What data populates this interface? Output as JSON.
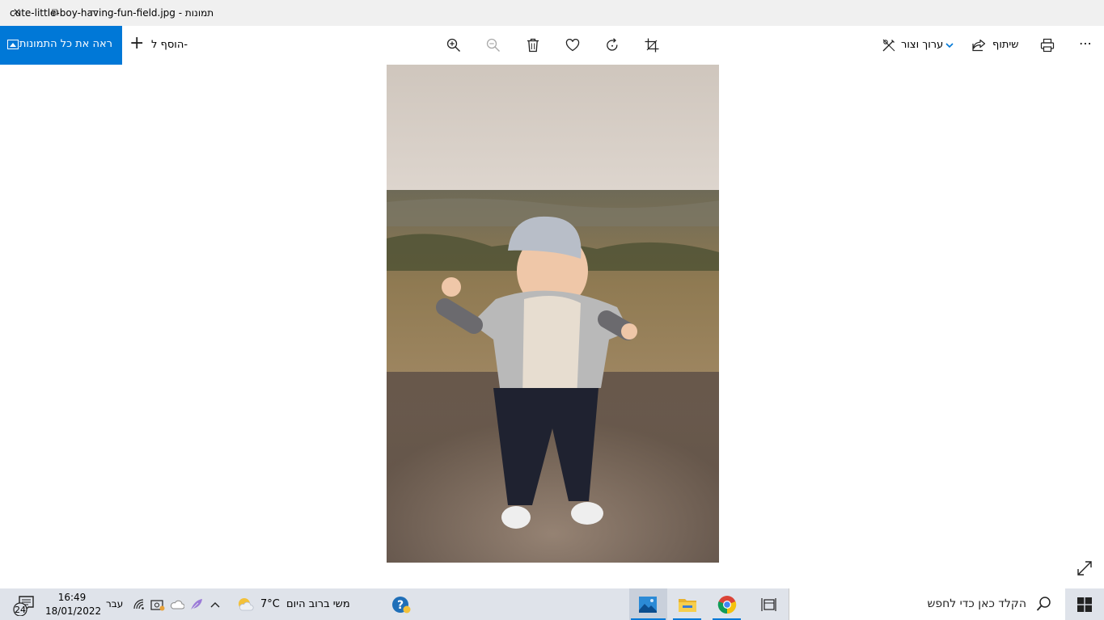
{
  "window": {
    "title": "cute-little-boy-having-fun-field.jpg - תמונות",
    "close_glyph": "✕",
    "restore_glyph": "⧉",
    "minimize_glyph": "—"
  },
  "toolbar": {
    "see_all_label": "ראה את כל התמונות",
    "add_to_label": "הוסף ל-",
    "edit_create_label": "ערוך וצור",
    "share_label": "שיתוף",
    "more_glyph": "⋯"
  },
  "icons": {
    "zoom_in": "zoom-in-icon",
    "zoom_out": "zoom-out-icon",
    "delete": "trash-icon",
    "favorite": "heart-icon",
    "rotate": "rotate-icon",
    "crop": "crop-icon",
    "print": "printer-icon",
    "fullscreen": "expand-icon"
  },
  "taskbar": {
    "search_placeholder": "הקלד כאן כדי לחפש",
    "weather_temp": "7°C",
    "weather_text": "משי ברוב היום",
    "language": "עבר",
    "time": "16:49",
    "date": "18/01/2022",
    "notification_count": "24"
  },
  "colors": {
    "accent": "#0078d7",
    "taskbar_bg": "#dfe3ea"
  }
}
